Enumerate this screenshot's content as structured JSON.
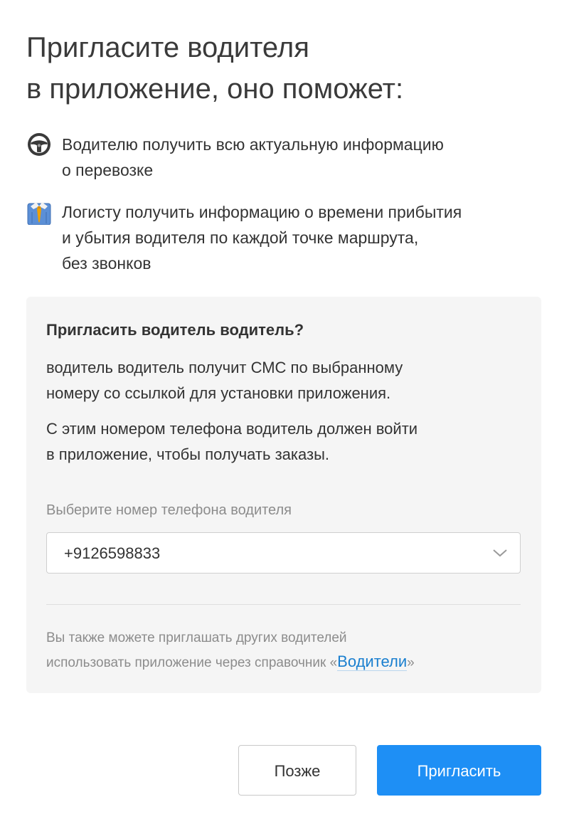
{
  "dialog": {
    "title_lines": [
      "Пригласите водителя",
      "в приложение, оно поможет:"
    ],
    "benefits": [
      {
        "icon": "steering-wheel-icon",
        "lines": [
          "Водителю получить всю актуальную информацию",
          "о перевозке"
        ]
      },
      {
        "icon": "necktie-person-icon",
        "lines": [
          "Логисту получить информацию о времени прибытия",
          "и убытия водителя по каждой точке маршрута,",
          "без звонков"
        ]
      }
    ],
    "panel": {
      "title": "Пригласить водитель водитель?",
      "desc1_lines": [
        "водитель водитель получит СМС по выбранному",
        "номеру со ссылкой для установки приложения."
      ],
      "desc2_lines": [
        "С этим номером телефона водитель должен войти",
        "в приложение, чтобы получать заказы."
      ],
      "phone_label": "Выберите номер телефона водителя",
      "phone_value": "+9126598833",
      "footnote_line1": "Вы также можете приглашать других водителей",
      "footnote_line2_before": "использовать приложение через справочник «",
      "footnote_link": "Водители",
      "footnote_line2_after": "»"
    },
    "buttons": {
      "later": "Позже",
      "invite": "Пригласить"
    }
  },
  "colors": {
    "primary": "#1e8ff5",
    "link": "#1a7fcf",
    "panel_bg": "#f5f5f5",
    "muted_text": "#8c8c8c"
  }
}
